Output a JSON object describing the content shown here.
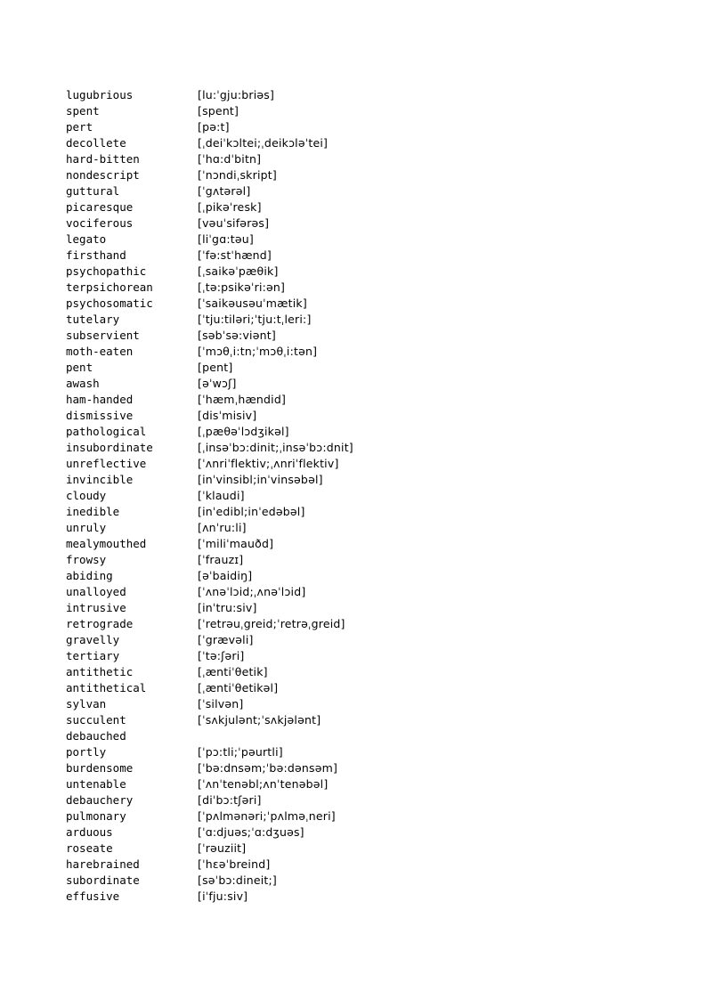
{
  "document": {
    "type": "vocabulary-pronunciation-list",
    "columns": [
      "word",
      "phonetic"
    ],
    "entries": [
      {
        "word": "lugubrious",
        "phonetic": "[lu:ˈgju:briəs]"
      },
      {
        "word": "spent",
        "phonetic": "[spent]"
      },
      {
        "word": "pert",
        "phonetic": "[pə:t]"
      },
      {
        "word": "decollete",
        "phonetic": "[ˌdeiˈkɔltei;ˌdeikɔləˈtei]"
      },
      {
        "word": "hard-bitten",
        "phonetic": "[ˈhɑ:dˈbitn]"
      },
      {
        "word": "nondescript",
        "phonetic": "[ˈnɔndiˌskript]"
      },
      {
        "word": "guttural",
        "phonetic": "[ˈgʌtərəl]"
      },
      {
        "word": "picaresque",
        "phonetic": "[ˌpikəˈresk]"
      },
      {
        "word": "vociferous",
        "phonetic": "[vəuˈsifərəs]"
      },
      {
        "word": "legato",
        "phonetic": "[liˈgɑ:təu]"
      },
      {
        "word": "firsthand",
        "phonetic": "[ˈfə:stˈhænd]"
      },
      {
        "word": "psychopathic",
        "phonetic": "[ˌsaikəˈpæθik]"
      },
      {
        "word": "terpsichorean",
        "phonetic": "[ˌtə:psikəˈri:ən]"
      },
      {
        "word": "psychosomatic",
        "phonetic": "[ˈsaikəusəuˈmætik]"
      },
      {
        "word": "tutelary",
        "phonetic": "[ˈtju:tiləri;ˈtju:tˌleri:]"
      },
      {
        "word": "subservient",
        "phonetic": "[səbˈsə:viənt]"
      },
      {
        "word": "moth-eaten",
        "phonetic": "[ˈmɔθˌi:tn;ˈmɔθˌi:tən]"
      },
      {
        "word": "pent",
        "phonetic": "[pent]"
      },
      {
        "word": "awash",
        "phonetic": "[əˈwɔʃ]"
      },
      {
        "word": "ham-handed",
        "phonetic": "[ˈhæmˌhændid]"
      },
      {
        "word": "dismissive",
        "phonetic": "[disˈmisiv]"
      },
      {
        "word": "pathological",
        "phonetic": "[ˌpæθəˈlɔdʒikəl]"
      },
      {
        "word": "insubordinate",
        "phonetic": "[ˌinsəˈbɔ:dinit;ˌinsəˈbɔ:dnit]"
      },
      {
        "word": "unreflective",
        "phonetic": "[ˈʌnriˈflektiv;ˌʌnriˈflektiv]"
      },
      {
        "word": "invincible",
        "phonetic": "[inˈvinsibl;inˈvinsəbəl]"
      },
      {
        "word": "cloudy",
        "phonetic": "[ˈklaudi]"
      },
      {
        "word": "inedible",
        "phonetic": "[inˈedibl;inˈedəbəl]"
      },
      {
        "word": "unruly",
        "phonetic": "[ʌnˈru:li]"
      },
      {
        "word": "mealymouthed",
        "phonetic": "[ˈmiliˈmauðd]"
      },
      {
        "word": "frowsy",
        "phonetic": "[ˈfrauzɪ]"
      },
      {
        "word": "abiding",
        "phonetic": "[əˈbaidiŋ]"
      },
      {
        "word": "unalloyed",
        "phonetic": "[ˈʌnəˈlɔid;ˌʌnəˈlɔid]"
      },
      {
        "word": "intrusive",
        "phonetic": "[inˈtru:siv]"
      },
      {
        "word": "retrograde",
        "phonetic": "[ˈretrəuˌgreid;ˈretrəˌgreid]"
      },
      {
        "word": "gravelly",
        "phonetic": "[ˈgrævəli]"
      },
      {
        "word": "tertiary",
        "phonetic": "[ˈtə:ʃəri]"
      },
      {
        "word": "antithetic",
        "phonetic": "[ˌæntiˈθetik]"
      },
      {
        "word": "antithetical",
        "phonetic": "[ˌæntiˈθetikəl]"
      },
      {
        "word": "sylvan",
        "phonetic": "[ˈsilvən]"
      },
      {
        "word": "succulent",
        "phonetic": "[ˈsʌkjulənt;ˈsʌkjələnt]"
      },
      {
        "word": "debauched",
        "phonetic": ""
      },
      {
        "word": "portly",
        "phonetic": "[ˈpɔ:tli;ˈpəurtli]"
      },
      {
        "word": "burdensome",
        "phonetic": "[ˈbə:dnsəm;ˈbə:dənsəm]"
      },
      {
        "word": "untenable",
        "phonetic": "[ˈʌnˈtenəbl;ʌnˈtenəbəl]"
      },
      {
        "word": "debauchery",
        "phonetic": "[diˈbɔ:tʃəri]"
      },
      {
        "word": "pulmonary",
        "phonetic": "[ˈpʌlmənəri;ˈpʌlməˌneri]"
      },
      {
        "word": "arduous",
        "phonetic": "[ˈɑ:djuəs;ˈɑ:dʒuəs]"
      },
      {
        "word": "roseate",
        "phonetic": "[ˈrəuziit]"
      },
      {
        "word": "harebrained",
        "phonetic": "[ˈhɛəˈbreind]"
      },
      {
        "word": "subordinate",
        "phonetic": "[səˈbɔ:dineit;]"
      },
      {
        "word": "effusive",
        "phonetic": "[iˈfju:siv]"
      }
    ]
  }
}
